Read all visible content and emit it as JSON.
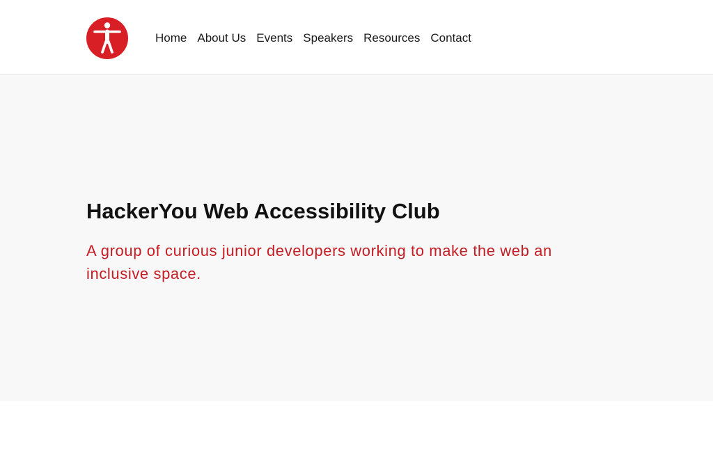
{
  "header": {
    "logo_icon": "accessibility-person-icon",
    "logo_color": "#d91f26",
    "nav": {
      "items": [
        {
          "label": "Home"
        },
        {
          "label": "About Us"
        },
        {
          "label": "Events"
        },
        {
          "label": "Speakers"
        },
        {
          "label": "Resources"
        },
        {
          "label": "Contact"
        }
      ]
    }
  },
  "hero": {
    "title": "HackerYou Web Accessibility Club",
    "tagline": "A group of curious junior developers working to make the web an inclusive space.",
    "background_color": "#f8f8f8",
    "tagline_color": "#c51d23"
  }
}
